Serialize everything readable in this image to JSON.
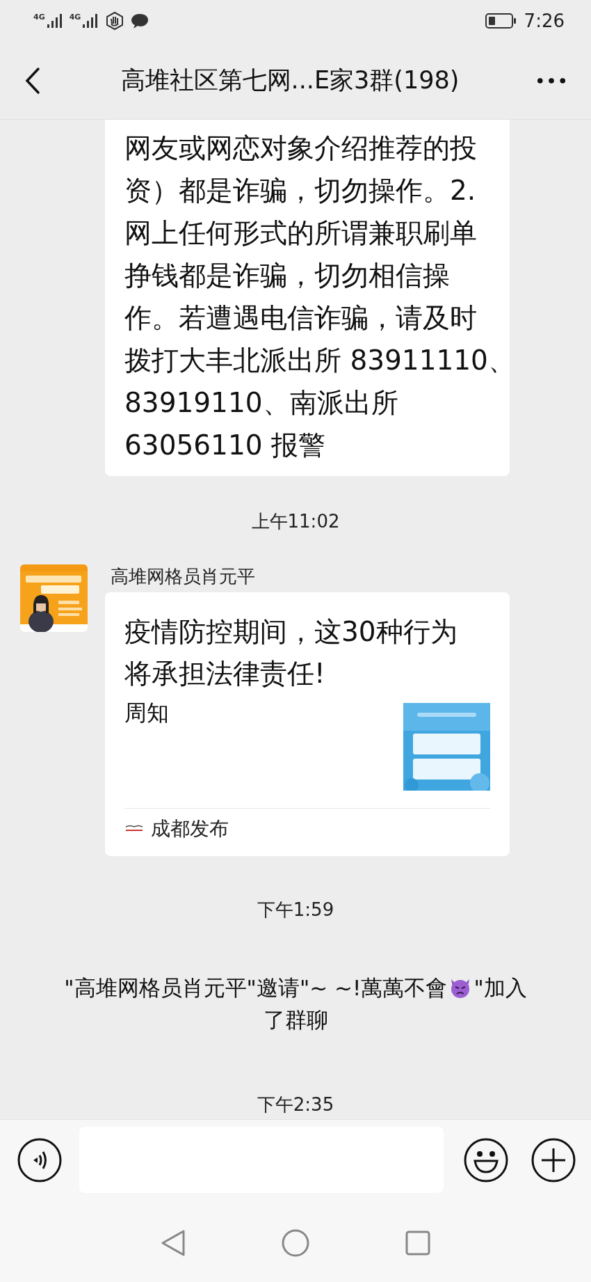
{
  "status_bar": {
    "network": [
      "4G",
      "4G"
    ],
    "time": "7:26"
  },
  "header": {
    "title": "高堆社区第七网...E家3群(198)"
  },
  "messages": [
    {
      "kind": "text",
      "lines": [
        "网友或网恋对象介绍推荐的投",
        "资）都是诈骗，切勿操作。2.",
        "网上任何形式的所谓兼职刷单",
        "挣钱都是诈骗，切勿相信操",
        "作。若遭遇电信诈骗，请及时",
        "拨打大丰北派出所 83911110、",
        "83919110、南派出所",
        "63056110 报警"
      ]
    },
    {
      "kind": "time",
      "text": "上午11:02"
    },
    {
      "kind": "link_card",
      "sender": "高堆网格员肖元平",
      "title_lines": [
        "疫情防控期间，这30种行为",
        "将承担法律责任!"
      ],
      "description": "周知",
      "source": "成都发布"
    },
    {
      "kind": "time",
      "text": "下午1:59"
    },
    {
      "kind": "system",
      "lines": [
        [
          {
            "kind": "text",
            "text": "\"高堆网格员肖元平\"邀请\"~ ~!萬萬不會"
          },
          {
            "kind": "emoji"
          },
          {
            "kind": "text",
            "text": "\"加入"
          }
        ],
        [
          {
            "kind": "text",
            "text": "了群聊"
          }
        ]
      ]
    },
    {
      "kind": "time",
      "text": "下午2:35"
    }
  ]
}
